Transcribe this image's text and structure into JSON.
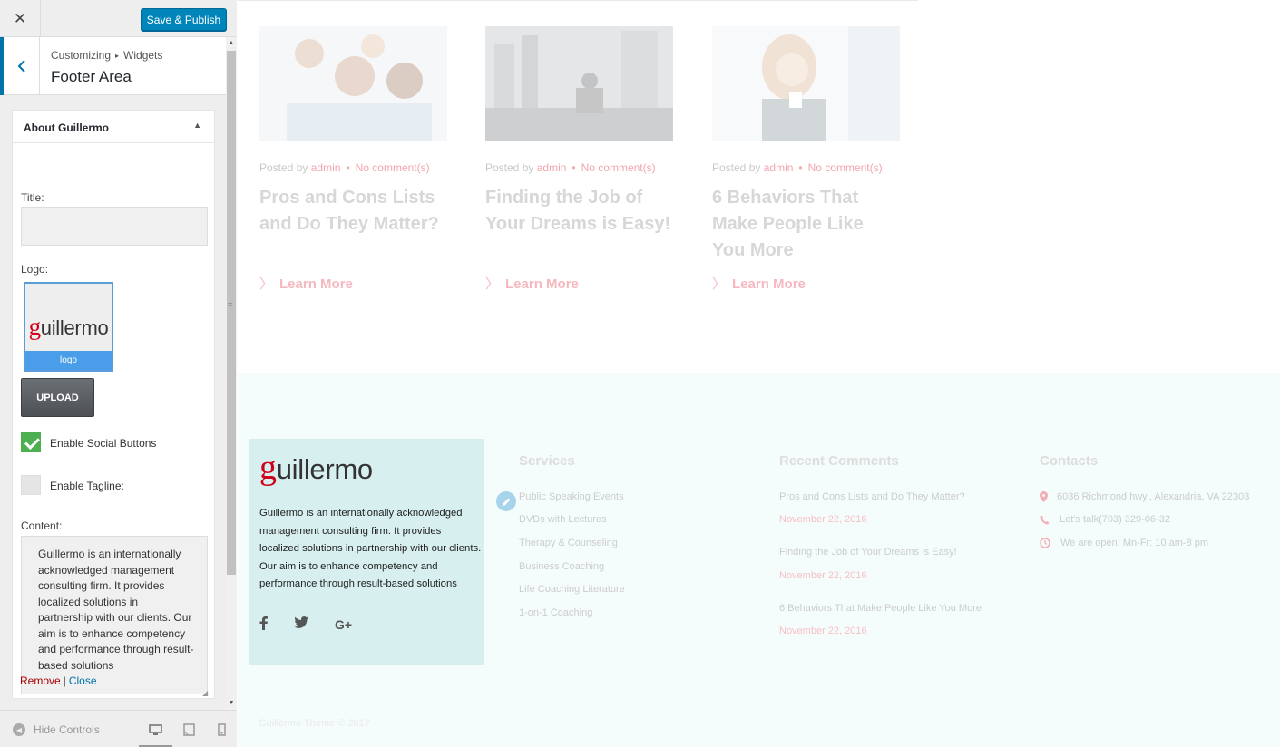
{
  "topbar": {
    "close_symbol": "✕",
    "save_label": "Save & Publish"
  },
  "section": {
    "crumb_parent": "Customizing",
    "crumb_child": "Widgets",
    "title": "Footer Area"
  },
  "widget": {
    "title": "About Guillermo",
    "title_label": "Title:",
    "title_value": "",
    "logo_label": "Logo:",
    "logo_g": "g",
    "logo_rest": "uillermo",
    "logo_caption": "logo",
    "upload_label": "UPLOAD",
    "social_label": "Enable Social Buttons",
    "social_checked": true,
    "tagline_label": "Enable Tagline:",
    "tagline_checked": false,
    "content_label": "Content:",
    "content_value": "Guillermo is an internationally acknowledged management consulting firm. It provides localized solutions in partnership with our clients. Our aim is to enhance competency and performance through result-based solutions",
    "remove_label": "Remove",
    "separator": "|",
    "close_label": "Close"
  },
  "bottom_bar": {
    "hide_controls_label": "Hide Controls"
  },
  "posts": [
    {
      "posted_by": "Posted by",
      "author": "admin",
      "comments": "No comment(s)",
      "title": "Pros and Cons Lists and Do They Matter?",
      "more": "Learn More"
    },
    {
      "posted_by": "Posted by",
      "author": "admin",
      "comments": "No comment(s)",
      "title": "Finding the Job of Your Dreams is Easy!",
      "more": "Learn More"
    },
    {
      "posted_by": "Posted by",
      "author": "admin",
      "comments": "No comment(s)",
      "title": "6 Behaviors That Make People Like You More",
      "more": "Learn More"
    }
  ],
  "footer": {
    "about": {
      "logo_g": "g",
      "logo_rest": "uillermo",
      "text": "Guillermo is an internationally acknowledged management consulting firm. It provides localized solutions in partnership with our clients. Our aim is to enhance competency and performance through result-based solutions"
    },
    "services": {
      "title": "Services",
      "items": [
        "Public Speaking Events",
        "DVDs with Lectures",
        "Therapy & Counseling",
        "Business Coaching",
        "Life Coaching Literature",
        "1-on-1 Coaching"
      ]
    },
    "recent_comments": {
      "title": "Recent Comments",
      "items": [
        {
          "text": "Pros and Cons Lists and Do They Matter?",
          "date": "November 22, 2016"
        },
        {
          "text": "Finding the Job of Your Dreams is Easy!",
          "date": "November 22, 2016"
        },
        {
          "text": "6 Behaviors That Make People Like You More",
          "date": "November 22, 2016"
        }
      ]
    },
    "contacts": {
      "title": "Contacts",
      "address": "6036 Richmond hwy., Alexandria, VA 22303",
      "phone": "Let's talk(703) 329-06-32",
      "hours": "We are open: Mn-Fr: 10 am-8 pm"
    },
    "copyright": "Guillermo Theme © 2017"
  },
  "colors": {
    "accent": "#0073aa",
    "save": "#0085ba",
    "brand_red": "#d0021b",
    "check_green": "#4cb050",
    "about_bg": "#d7f0ef"
  }
}
